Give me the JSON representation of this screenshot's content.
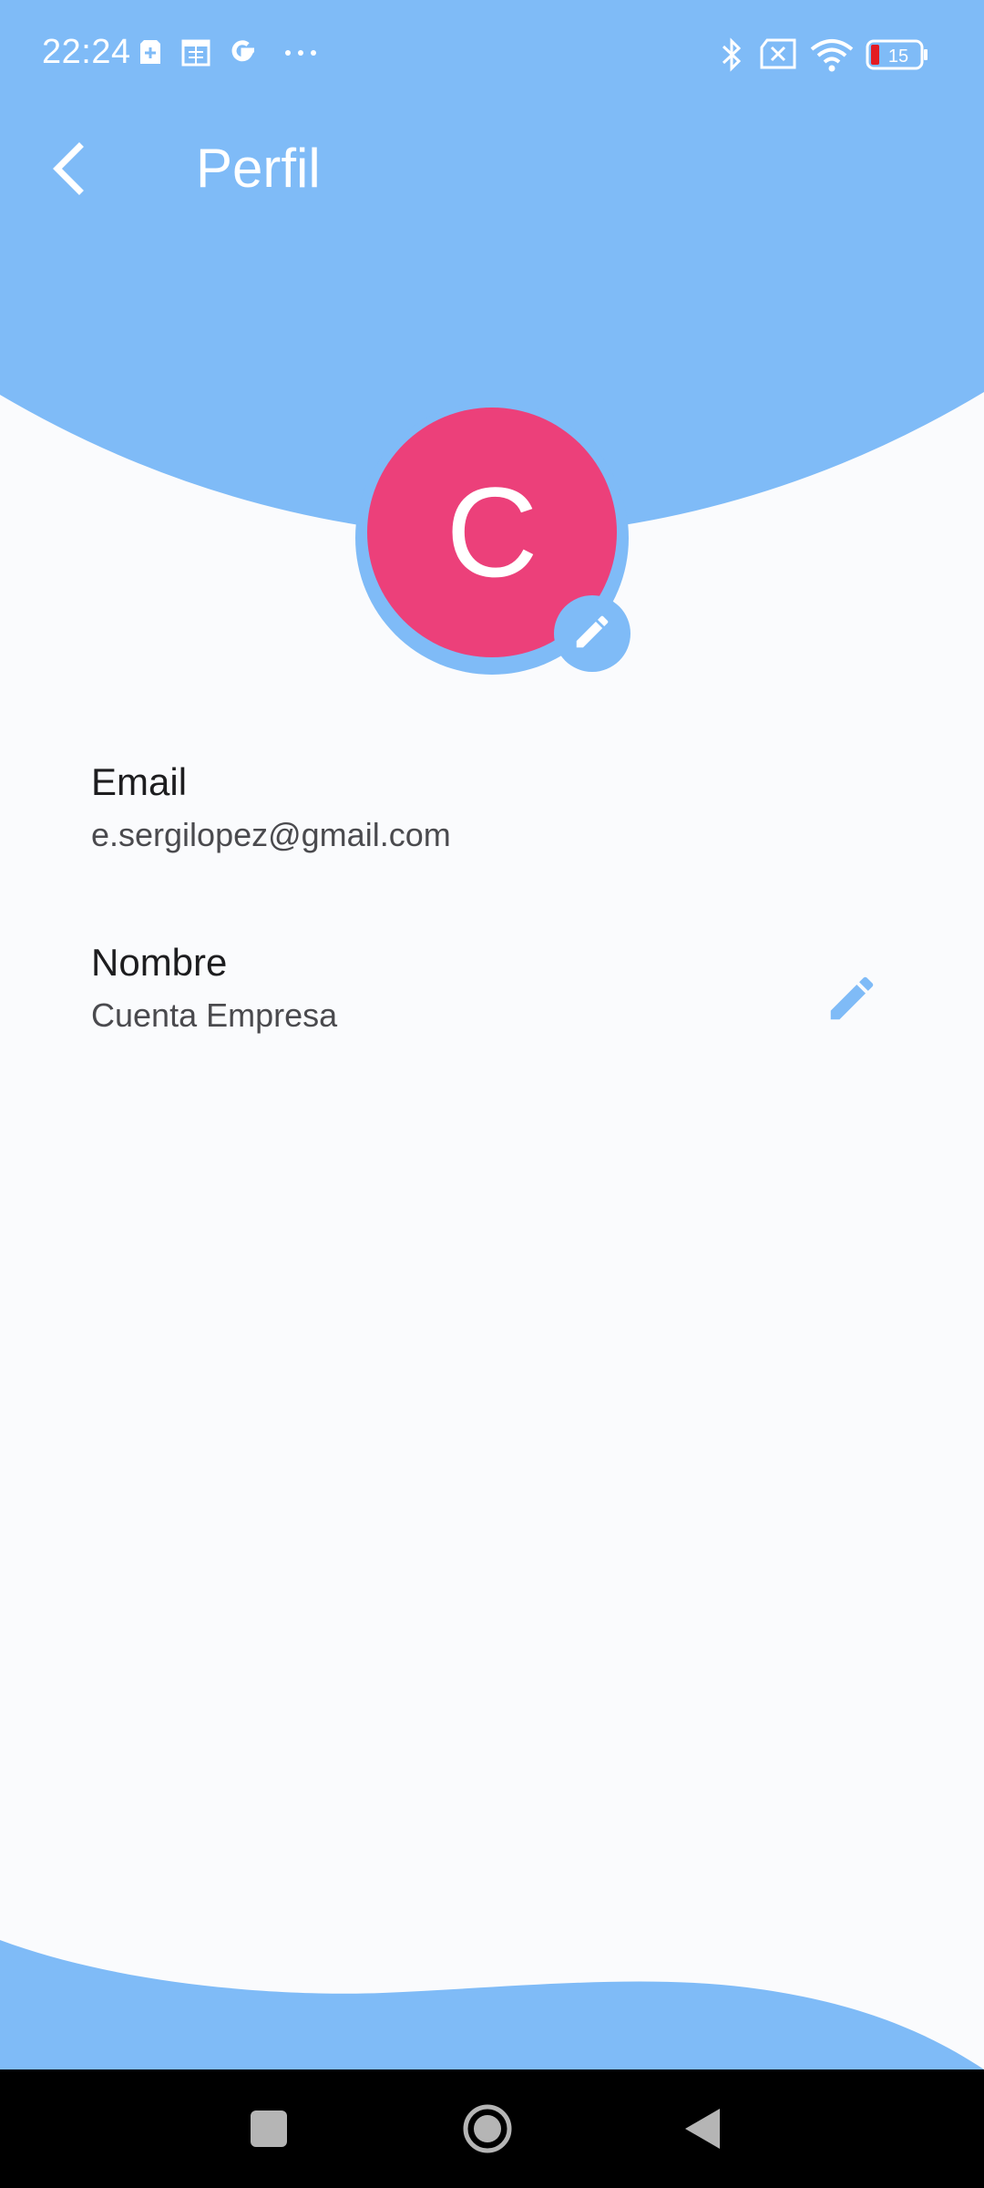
{
  "colors": {
    "header_blue": "#7fbbf7",
    "avatar_pink": "#ec407a",
    "background": "#fafbfd",
    "nav_bar": "#000000"
  },
  "status_bar": {
    "time": "22:24",
    "battery_level": "15",
    "icons": [
      "sim-toolkit-icon",
      "calendar-icon",
      "google-icon",
      "more-dots-icon",
      "bluetooth-icon",
      "no-sim-icon",
      "wifi-icon",
      "battery-icon"
    ]
  },
  "app_bar": {
    "title": "Perfil",
    "back_icon": "chevron-left-icon"
  },
  "avatar": {
    "initial": "C",
    "edit_icon": "pencil-icon"
  },
  "fields": {
    "email": {
      "label": "Email",
      "value": "e.sergilopez@gmail.com"
    },
    "name": {
      "label": "Nombre",
      "value": "Cuenta Empresa",
      "edit_icon": "pencil-icon"
    }
  },
  "nav_bar": {
    "buttons": [
      "recents-square-icon",
      "home-circle-icon",
      "back-triangle-icon"
    ]
  }
}
